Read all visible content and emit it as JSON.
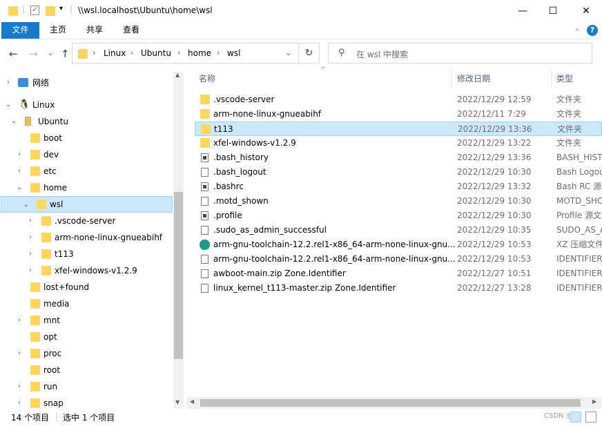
{
  "window": {
    "title": "\\\\wsl.localhost\\Ubuntu\\home\\wsl",
    "minimize": "—",
    "maximize": "☐",
    "close": "✕"
  },
  "ribbon": {
    "tabs": [
      "文件",
      "主页",
      "共享",
      "查看"
    ],
    "help": "?"
  },
  "address": {
    "crumbs": [
      "Linux",
      "Ubuntu",
      "home",
      "wsl"
    ],
    "search_placeholder": "在 wsl 中搜索"
  },
  "tree": {
    "network": "网络",
    "linux": "Linux",
    "ubuntu": "Ubuntu",
    "items": [
      "boot",
      "dev",
      "etc",
      "home",
      "wsl",
      ".vscode-server",
      "arm-none-linux-gnueabihf",
      "t113",
      "xfel-windows-v1.2.9",
      "lost+found",
      "media",
      "mnt",
      "opt",
      "proc",
      "root",
      "run",
      "snap"
    ]
  },
  "columns": {
    "name": "名称",
    "date": "修改日期",
    "type": "类型"
  },
  "files": [
    {
      "name": ".vscode-server",
      "date": "2022/12/29 12:59",
      "type": "文件夹",
      "icon": "folder"
    },
    {
      "name": "arm-none-linux-gnueabihf",
      "date": "2022/12/11 7:29",
      "type": "文件夹",
      "icon": "folder"
    },
    {
      "name": "t113",
      "date": "2022/12/29 13:36",
      "type": "文件夹",
      "icon": "folder"
    },
    {
      "name": "xfel-windows-v1.2.9",
      "date": "2022/12/29 13:22",
      "type": "文件夹",
      "icon": "folder"
    },
    {
      "name": ".bash_history",
      "date": "2022/12/29 13:36",
      "type": "BASH_HISTORY",
      "icon": "file-dark"
    },
    {
      "name": ".bash_logout",
      "date": "2022/12/29 10:30",
      "type": "Bash Logout",
      "icon": "file"
    },
    {
      "name": ".bashrc",
      "date": "2022/12/29 13:32",
      "type": "Bash RC 源",
      "icon": "file-dark"
    },
    {
      "name": ".motd_shown",
      "date": "2022/12/29 10:30",
      "type": "MOTD_SHOWN",
      "icon": "file"
    },
    {
      "name": ".profile",
      "date": "2022/12/29 10:30",
      "type": "Profile 源文件",
      "icon": "file-dark"
    },
    {
      "name": ".sudo_as_admin_successful",
      "date": "2022/12/29 10:35",
      "type": "SUDO_AS_ADMIN",
      "icon": "file"
    },
    {
      "name": "arm-gnu-toolchain-12.2.rel1-x86_64-arm-none-linux-gnu...",
      "date": "2022/12/29 10:53",
      "type": "XZ 压缩文件",
      "icon": "xz"
    },
    {
      "name": "arm-gnu-toolchain-12.2.rel1-x86_64-arm-none-linux-gnu...",
      "date": "2022/12/29 10:53",
      "type": "IDENTIFIER",
      "icon": "file"
    },
    {
      "name": "awboot-main.zip   Zone.Identifier",
      "date": "2022/12/27 10:51",
      "type": "IDENTIFIER",
      "icon": "file"
    },
    {
      "name": "linux_kernel_t113-master.zip   Zone.Identifier",
      "date": "2022/12/27 13:28",
      "type": "IDENTIFIER",
      "icon": "file"
    }
  ],
  "status": {
    "count": "14 个项目",
    "selected": "选中 1 个项目",
    "watermark": "CSDN @…"
  },
  "colors": {
    "accent": "#1979ca",
    "selection": "#cce8ff",
    "folder": "#ffd75e"
  }
}
